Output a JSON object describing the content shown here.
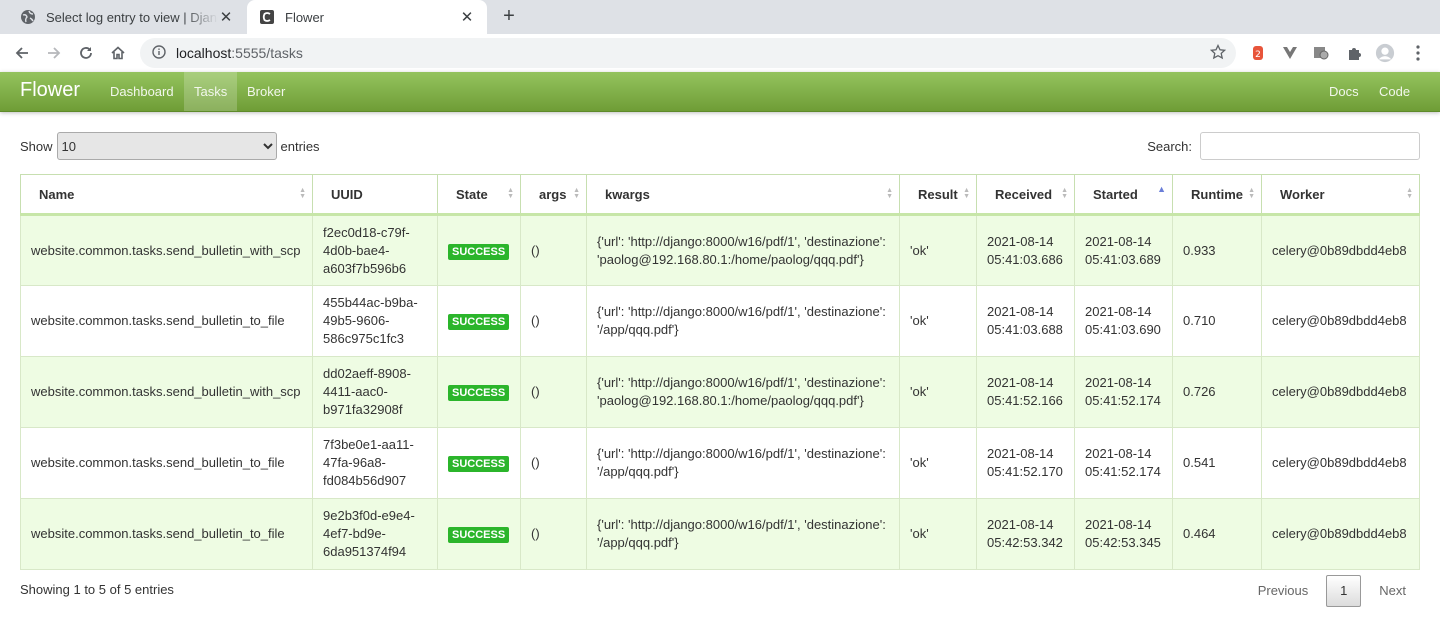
{
  "browser": {
    "tabs": [
      {
        "title": "Select log entry to view | Django site admin",
        "active": false
      },
      {
        "title": "Flower",
        "active": true
      }
    ],
    "url_host": "localhost",
    "url_path": ":5555/tasks"
  },
  "navbar": {
    "brand": "Flower",
    "links": [
      "Dashboard",
      "Tasks",
      "Broker"
    ],
    "active_link": "Tasks",
    "right_links": [
      "Docs",
      "Code"
    ]
  },
  "controls": {
    "show_label": "Show",
    "entries_value": "10",
    "entries_label": "entries",
    "search_label": "Search:",
    "search_value": ""
  },
  "table": {
    "columns": [
      "Name",
      "UUID",
      "State",
      "args",
      "kwargs",
      "Result",
      "Received",
      "Started",
      "Runtime",
      "Worker"
    ],
    "sorted_column": "Started",
    "rows": [
      {
        "name": "website.common.tasks.send_bulletin_with_scp",
        "uuid": "f2ec0d18-c79f-4d0b-bae4-a603f7b596b6",
        "state": "SUCCESS",
        "args": "()",
        "kwargs": "{'url': 'http://django:8000/w16/pdf/1', 'destinazione': 'paolog@192.168.80.1:/home/paolog/qqq.pdf'}",
        "result": "'ok'",
        "received": "2021-08-14 05:41:03.686",
        "started": "2021-08-14 05:41:03.689",
        "runtime": "0.933",
        "worker": "celery@0b89dbdd4eb8"
      },
      {
        "name": "website.common.tasks.send_bulletin_to_file",
        "uuid": "455b44ac-b9ba-49b5-9606-586c975c1fc3",
        "state": "SUCCESS",
        "args": "()",
        "kwargs": "{'url': 'http://django:8000/w16/pdf/1', 'destinazione': '/app/qqq.pdf'}",
        "result": "'ok'",
        "received": "2021-08-14 05:41:03.688",
        "started": "2021-08-14 05:41:03.690",
        "runtime": "0.710",
        "worker": "celery@0b89dbdd4eb8"
      },
      {
        "name": "website.common.tasks.send_bulletin_with_scp",
        "uuid": "dd02aeff-8908-4411-aac0-b971fa32908f",
        "state": "SUCCESS",
        "args": "()",
        "kwargs": "{'url': 'http://django:8000/w16/pdf/1', 'destinazione': 'paolog@192.168.80.1:/home/paolog/qqq.pdf'}",
        "result": "'ok'",
        "received": "2021-08-14 05:41:52.166",
        "started": "2021-08-14 05:41:52.174",
        "runtime": "0.726",
        "worker": "celery@0b89dbdd4eb8"
      },
      {
        "name": "website.common.tasks.send_bulletin_to_file",
        "uuid": "7f3be0e1-aa11-47fa-96a8-fd084b56d907",
        "state": "SUCCESS",
        "args": "()",
        "kwargs": "{'url': 'http://django:8000/w16/pdf/1', 'destinazione': '/app/qqq.pdf'}",
        "result": "'ok'",
        "received": "2021-08-14 05:41:52.170",
        "started": "2021-08-14 05:41:52.174",
        "runtime": "0.541",
        "worker": "celery@0b89dbdd4eb8"
      },
      {
        "name": "website.common.tasks.send_bulletin_to_file",
        "uuid": "9e2b3f0d-e9e4-4ef7-bd9e-6da951374f94",
        "state": "SUCCESS",
        "args": "()",
        "kwargs": "{'url': 'http://django:8000/w16/pdf/1', 'destinazione': '/app/qqq.pdf'}",
        "result": "'ok'",
        "received": "2021-08-14 05:42:53.342",
        "started": "2021-08-14 05:42:53.345",
        "runtime": "0.464",
        "worker": "celery@0b89dbdd4eb8"
      }
    ]
  },
  "footer": {
    "info": "Showing 1 to 5 of 5 entries",
    "previous": "Previous",
    "page": "1",
    "next": "Next"
  },
  "colors": {
    "navbar_top": "#94c35e",
    "navbar_bottom": "#6f9d36",
    "link_green": "#2e8b1f",
    "success_badge": "#2bb52b",
    "odd_row": "#eefce3"
  },
  "icons": [
    "globe-icon",
    "flower-favicon",
    "close-icon",
    "plus-icon",
    "back-icon",
    "forward-icon",
    "reload-icon",
    "home-icon",
    "info-icon",
    "star-icon",
    "extension-icons",
    "puzzle-icon",
    "profile-icon",
    "menu-icon"
  ]
}
